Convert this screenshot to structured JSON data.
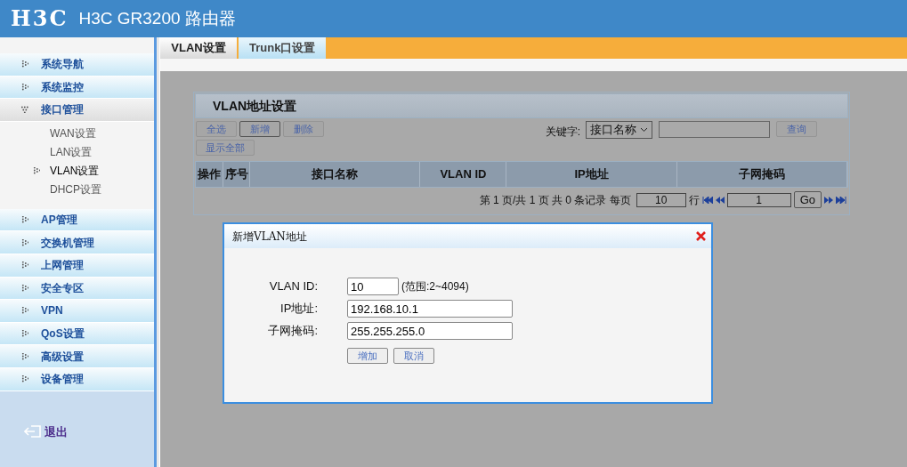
{
  "header": {
    "logo": "H3C",
    "title": "H3C GR3200 路由器"
  },
  "sidebar": {
    "items": [
      {
        "label": "系统导航",
        "expanded": false
      },
      {
        "label": "系统监控",
        "expanded": false
      },
      {
        "label": "接口管理",
        "expanded": true,
        "children": [
          {
            "label": "WAN设置",
            "selected": false
          },
          {
            "label": "LAN设置",
            "selected": false
          },
          {
            "label": "VLAN设置",
            "selected": true
          },
          {
            "label": "DHCP设置",
            "selected": false
          }
        ]
      },
      {
        "label": "AP管理",
        "expanded": false
      },
      {
        "label": "交换机管理",
        "expanded": false
      },
      {
        "label": "上网管理",
        "expanded": false
      },
      {
        "label": "安全专区",
        "expanded": false
      },
      {
        "label": "VPN",
        "expanded": false
      },
      {
        "label": "QoS设置",
        "expanded": false
      },
      {
        "label": "高级设置",
        "expanded": false
      },
      {
        "label": "设备管理",
        "expanded": false
      }
    ],
    "logout": "退出"
  },
  "tabs": [
    {
      "label": "VLAN设置",
      "selected": true
    },
    {
      "label": "Trunk口设置",
      "selected": false
    }
  ],
  "panel": {
    "title": "VLAN地址设置",
    "buttons": [
      {
        "label": "全选",
        "focused": false
      },
      {
        "label": "新增",
        "focused": true
      },
      {
        "label": "删除",
        "focused": false
      },
      {
        "label": "显示全部",
        "focused": false
      }
    ],
    "keyword_label": "关键字:",
    "keyword_select": "接口名称",
    "search_button": "查询",
    "columns": [
      "操作",
      "序号",
      "接口名称",
      "VLAN ID",
      "IP地址",
      "子网掩码"
    ],
    "pagination": {
      "summary": "第 1 页/共 1 页 共 0 条记录 每页",
      "rows_per_page": "10",
      "rows_unit": "行",
      "page": "1",
      "go": "Go"
    }
  },
  "dialog": {
    "title": "新增VLAN地址",
    "fields": [
      {
        "label": "VLAN ID:",
        "value": "10",
        "hint": "(范围:2~4094)",
        "kind": "short"
      },
      {
        "label": "IP地址:",
        "value": "192.168.10.1",
        "kind": "long"
      },
      {
        "label": "子网掩码:",
        "value": "255.255.255.0",
        "kind": "long"
      }
    ],
    "buttons": [
      "增加",
      "取消"
    ]
  }
}
